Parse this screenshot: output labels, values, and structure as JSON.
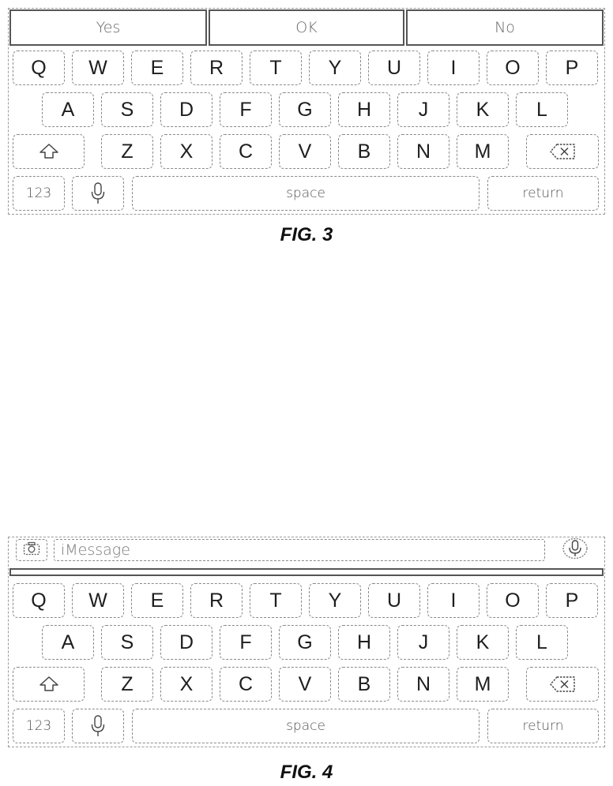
{
  "fig3": {
    "caption": "FIG. 3",
    "suggestions": [
      "Yes",
      "OK",
      "No"
    ]
  },
  "fig4": {
    "caption": "FIG. 4",
    "message_placeholder": "iMessage"
  },
  "keyboard": {
    "row1": [
      "Q",
      "W",
      "E",
      "R",
      "T",
      "Y",
      "U",
      "I",
      "O",
      "P"
    ],
    "row2": [
      "A",
      "S",
      "D",
      "F",
      "G",
      "H",
      "J",
      "K",
      "L"
    ],
    "row3": [
      "Z",
      "X",
      "C",
      "V",
      "B",
      "N",
      "M"
    ],
    "numbers_label": "123",
    "space_label": "space",
    "return_label": "return",
    "icons": {
      "shift": "shift-icon",
      "delete": "delete-icon",
      "mic": "microphone-icon",
      "camera": "camera-icon",
      "audio": "audio-message-icon"
    }
  },
  "colors": {
    "key_border": "#8a8a8a",
    "frame_border": "#555555"
  }
}
